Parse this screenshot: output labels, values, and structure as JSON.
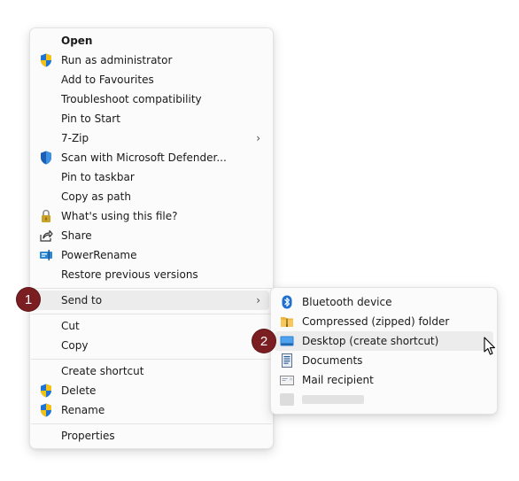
{
  "context_menu": {
    "items": [
      {
        "label": "Open",
        "icon": "none",
        "bold": true
      },
      {
        "label": "Run as administrator",
        "icon": "uac-shield-icon"
      },
      {
        "label": "Add to Favourites",
        "icon": "none"
      },
      {
        "label": "Troubleshoot compatibility",
        "icon": "none"
      },
      {
        "label": "Pin to Start",
        "icon": "none"
      },
      {
        "label": "7-Zip",
        "icon": "none",
        "submenu": true
      },
      {
        "label": "Scan with Microsoft Defender...",
        "icon": "defender-shield-icon"
      },
      {
        "label": "Pin to taskbar",
        "icon": "none"
      },
      {
        "label": "Copy as path",
        "icon": "none"
      },
      {
        "label": "What's using this file?",
        "icon": "padlock-icon"
      },
      {
        "label": "Share",
        "icon": "share-icon"
      },
      {
        "label": "PowerRename",
        "icon": "powerrename-icon"
      },
      {
        "label": "Restore previous versions",
        "icon": "none"
      },
      {
        "label": "Send to",
        "icon": "none",
        "submenu": true,
        "highlighted": true
      },
      {
        "label": "Cut",
        "icon": "none"
      },
      {
        "label": "Copy",
        "icon": "none"
      },
      {
        "label": "Create shortcut",
        "icon": "none"
      },
      {
        "label": "Delete",
        "icon": "uac-shield-icon"
      },
      {
        "label": "Rename",
        "icon": "uac-shield-icon"
      },
      {
        "label": "Properties",
        "icon": "none"
      }
    ],
    "chevron": "›"
  },
  "send_to_menu": {
    "items": [
      {
        "label": "Bluetooth device",
        "icon": "bluetooth-icon"
      },
      {
        "label": "Compressed (zipped) folder",
        "icon": "zip-folder-icon"
      },
      {
        "label": "Desktop (create shortcut)",
        "icon": "desktop-icon",
        "highlighted": true
      },
      {
        "label": "Documents",
        "icon": "documents-icon"
      },
      {
        "label": "Mail recipient",
        "icon": "mail-icon"
      },
      {
        "label": "",
        "icon": "blurred-icon",
        "redacted": true
      }
    ]
  },
  "callouts": [
    {
      "number": "1"
    },
    {
      "number": "2"
    }
  ],
  "colors": {
    "menu_bg": "#fbfbfb",
    "highlight": "#ececec",
    "badge": "#7b1e21",
    "shield_blue": "#1e73d6",
    "shield_yellow": "#f5c211"
  }
}
